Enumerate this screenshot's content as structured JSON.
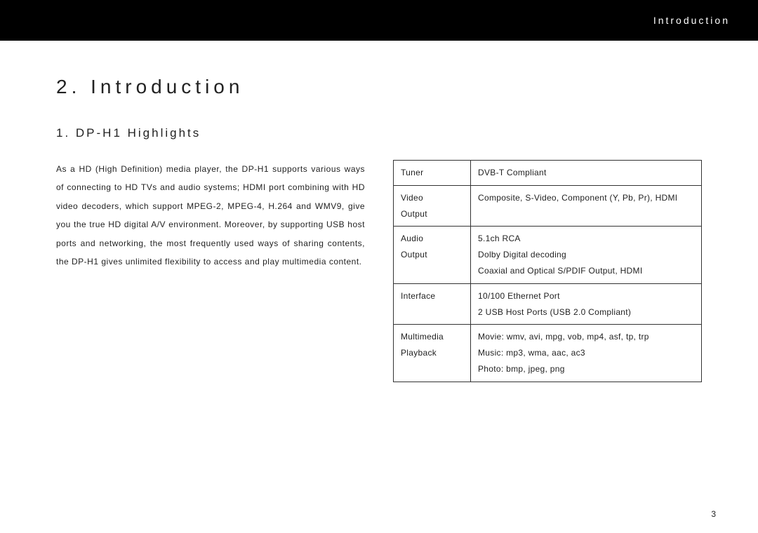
{
  "header": {
    "label": "Introduction"
  },
  "chapter": {
    "title": "2.  Introduction"
  },
  "subsection": {
    "title": "1. DP-H1 Highlights"
  },
  "body": {
    "paragraph": "As a HD (High Definition) media player, the DP-H1 supports various ways of connecting to HD TVs and audio systems; HDMI port combining with HD video decoders, which support MPEG-2, MPEG-4, H.264 and WMV9, give you the true HD digital A/V environment. Moreover, by supporting USB host ports and networking, the most frequently used ways of sharing contents, the DP-H1 gives unlimited flexibility to access and play multimedia content."
  },
  "specs": {
    "rows": [
      {
        "label": "Tuner",
        "lines": [
          "DVB-T Compliant"
        ]
      },
      {
        "label": "Video Output",
        "lines": [
          "Composite, S-Video, Component (Y, Pb, Pr), HDMI"
        ]
      },
      {
        "label": "Audio Output",
        "lines": [
          "5.1ch RCA",
          "Dolby Digital decoding",
          "Coaxial and Optical S/PDIF Output, HDMI"
        ]
      },
      {
        "label": "Interface",
        "lines": [
          "10/100 Ethernet Port",
          "2 USB Host Ports (USB 2.0 Compliant)"
        ]
      },
      {
        "label": "Multimedia Playback",
        "lines": [
          "Movie: wmv, avi, mpg, vob, mp4, asf, tp, trp",
          "Music: mp3, wma, aac, ac3",
          "Photo: bmp, jpeg, png"
        ]
      }
    ]
  },
  "page_number": "3"
}
